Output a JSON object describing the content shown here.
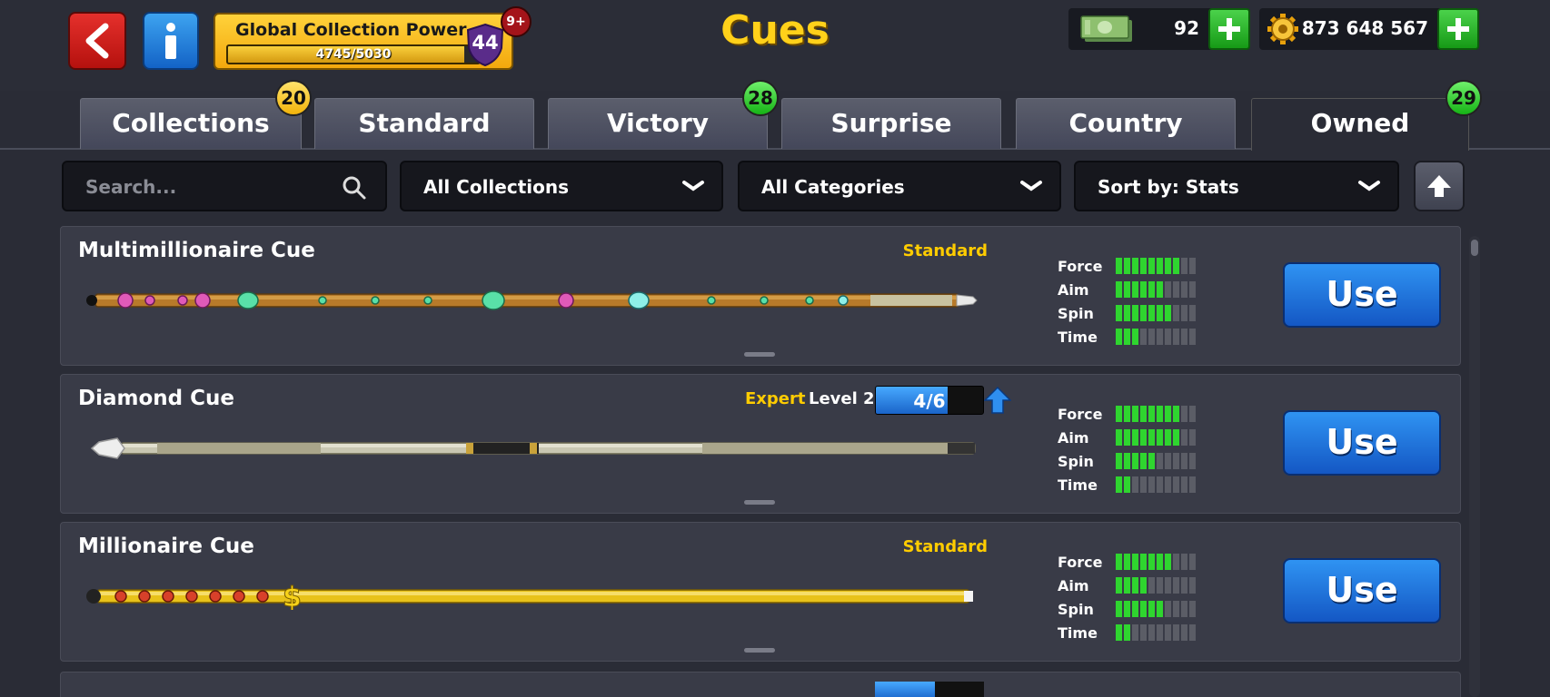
{
  "header": {
    "title": "Cues",
    "power": {
      "label": "Global Collection Power",
      "progress": "4745/5030",
      "progress_fraction": 0.943,
      "level": "44",
      "notification": "9+"
    },
    "currency": {
      "cash": "92",
      "coins": "873 648 567"
    }
  },
  "tabs": [
    {
      "label": "Collections",
      "badge": "20",
      "badge_color": "#f2b30b"
    },
    {
      "label": "Standard"
    },
    {
      "label": "Victory",
      "badge": "28",
      "badge_color": "#16b316"
    },
    {
      "label": "Surprise"
    },
    {
      "label": "Country"
    },
    {
      "label": "Owned",
      "badge": "29",
      "badge_color": "#16b316",
      "active": true
    }
  ],
  "filters": {
    "search_placeholder": "Search...",
    "collections": "All Collections",
    "categories": "All Categories",
    "sort": "Sort by: Stats"
  },
  "stat_labels": [
    "Force",
    "Aim",
    "Spin",
    "Time"
  ],
  "cues": [
    {
      "name": "Multimillionaire Cue",
      "category": "Standard",
      "stats": [
        8,
        6,
        7,
        3
      ],
      "use_label": "Use"
    },
    {
      "name": "Diamond Cue",
      "expert": "Expert",
      "level": "Level 2",
      "level_progress": "4/6",
      "level_fraction": 0.667,
      "stats": [
        8,
        8,
        5,
        2
      ],
      "use_label": "Use"
    },
    {
      "name": "Millionaire Cue",
      "category": "Standard",
      "stats": [
        7,
        4,
        6,
        2
      ],
      "use_label": "Use"
    }
  ],
  "stat_max": 10
}
